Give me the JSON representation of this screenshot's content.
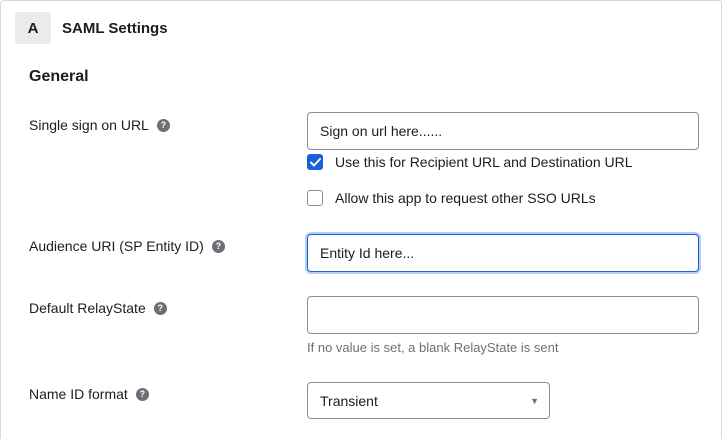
{
  "panel": {
    "step_badge": "A",
    "title": "SAML Settings"
  },
  "section": {
    "title": "General"
  },
  "fields": {
    "sso_url": {
      "label": "Single sign on URL",
      "value": "Sign on url here......"
    },
    "recipient_checkbox": {
      "label": "Use this for Recipient URL and Destination URL",
      "checked": true
    },
    "other_sso_checkbox": {
      "label": "Allow this app to request other SSO URLs",
      "checked": false
    },
    "audience_uri": {
      "label": "Audience URI (SP Entity ID)",
      "value": "Entity Id here..."
    },
    "relay_state": {
      "label": "Default RelayState",
      "value": "",
      "hint": "If no value is set, a blank RelayState is sent"
    },
    "name_id_format": {
      "label": "Name ID format",
      "selected": "Transient"
    }
  },
  "icons": {
    "help": "?",
    "caret": "▼"
  },
  "colors": {
    "accent": "#1662dd",
    "focus_ring": "#b9cdf4",
    "border": "#8c8c96",
    "muted_text": "#6e6e78"
  }
}
